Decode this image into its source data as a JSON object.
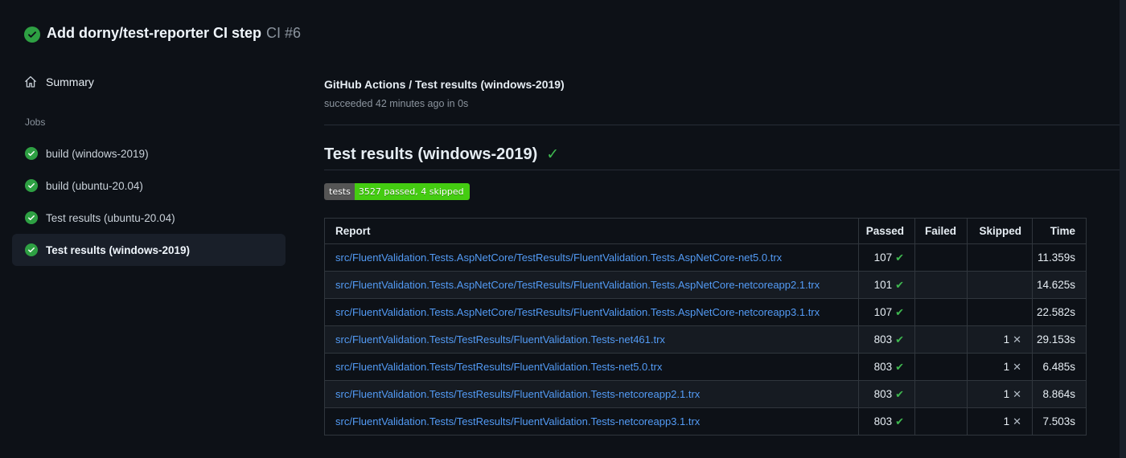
{
  "header": {
    "title": "Add dorny/test-reporter CI step",
    "run_number": "CI #6",
    "status_icon": "check-circle-icon"
  },
  "sidebar": {
    "summary_label": "Summary",
    "jobs_label": "Jobs",
    "jobs": [
      {
        "label": "build (windows-2019)",
        "selected": false,
        "status_icon": "check-circle-icon"
      },
      {
        "label": "build (ubuntu-20.04)",
        "selected": false,
        "status_icon": "check-circle-icon"
      },
      {
        "label": "Test results (ubuntu-20.04)",
        "selected": false,
        "status_icon": "check-circle-icon"
      },
      {
        "label": "Test results (windows-2019)",
        "selected": true,
        "status_icon": "check-circle-icon"
      }
    ]
  },
  "main": {
    "breadcrumb": "GitHub Actions / Test results (windows-2019)",
    "status_line": "succeeded 42 minutes ago in 0s",
    "section_title": "Test results (windows-2019)",
    "section_check": "✓",
    "badge": {
      "label": "tests",
      "value": "3527 passed, 4 skipped",
      "label_bg": "#555555",
      "value_bg": "#44cc11"
    },
    "table": {
      "columns": [
        "Report",
        "Passed",
        "Failed",
        "Skipped",
        "Time"
      ],
      "rows": [
        {
          "report": "src/FluentValidation.Tests.AspNetCore/TestResults/FluentValidation.Tests.AspNetCore-net5.0.trx",
          "passed": "107",
          "failed": "",
          "skipped": "",
          "time": "11.359s"
        },
        {
          "report": "src/FluentValidation.Tests.AspNetCore/TestResults/FluentValidation.Tests.AspNetCore-netcoreapp2.1.trx",
          "passed": "101",
          "failed": "",
          "skipped": "",
          "time": "14.625s"
        },
        {
          "report": "src/FluentValidation.Tests.AspNetCore/TestResults/FluentValidation.Tests.AspNetCore-netcoreapp3.1.trx",
          "passed": "107",
          "failed": "",
          "skipped": "",
          "time": "22.582s"
        },
        {
          "report": "src/FluentValidation.Tests/TestResults/FluentValidation.Tests-net461.trx",
          "passed": "803",
          "failed": "",
          "skipped": "1",
          "time": "29.153s"
        },
        {
          "report": "src/FluentValidation.Tests/TestResults/FluentValidation.Tests-net5.0.trx",
          "passed": "803",
          "failed": "",
          "skipped": "1",
          "time": "6.485s"
        },
        {
          "report": "src/FluentValidation.Tests/TestResults/FluentValidation.Tests-netcoreapp2.1.trx",
          "passed": "803",
          "failed": "",
          "skipped": "1",
          "time": "8.864s"
        },
        {
          "report": "src/FluentValidation.Tests/TestResults/FluentValidation.Tests-netcoreapp3.1.trx",
          "passed": "803",
          "failed": "",
          "skipped": "1",
          "time": "7.503s"
        }
      ]
    }
  },
  "icons": {
    "passed_mark": "✔",
    "skipped_mark": "✕"
  },
  "colors": {
    "background": "#0d1117",
    "success_green": "#2ea043",
    "check_green": "#3fb950",
    "link_blue": "#539bf5",
    "muted_text": "#8b949e",
    "table_border": "#30363d"
  }
}
